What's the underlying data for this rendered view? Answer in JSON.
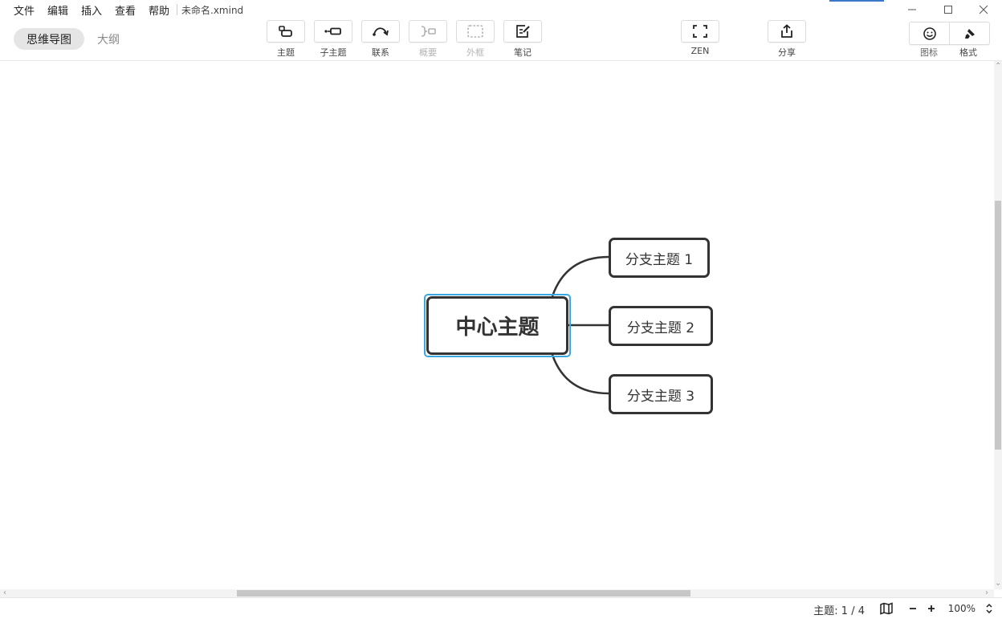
{
  "menu": {
    "items": [
      "文件",
      "编辑",
      "插入",
      "查看",
      "帮助"
    ],
    "file_title": "未命名.xmind"
  },
  "toolbar": {
    "tab_mindmap": "思维导图",
    "tab_outline": "大纲",
    "topic": "主题",
    "subtopic": "子主题",
    "relationship": "联系",
    "summary": "概要",
    "boundary": "外框",
    "note": "笔记",
    "zen": "ZEN",
    "share": "分享",
    "icon": "图标",
    "format": "格式"
  },
  "mindmap": {
    "central": "中心主题",
    "branches": [
      "分支主题 1",
      "分支主题 2",
      "分支主题 3"
    ]
  },
  "status": {
    "topic_count": "主题: 1 / 4",
    "zoom": "100%"
  },
  "colors": {
    "selection": "#3aa7e0",
    "node_border": "#333333",
    "accent": "#3a78c9"
  }
}
